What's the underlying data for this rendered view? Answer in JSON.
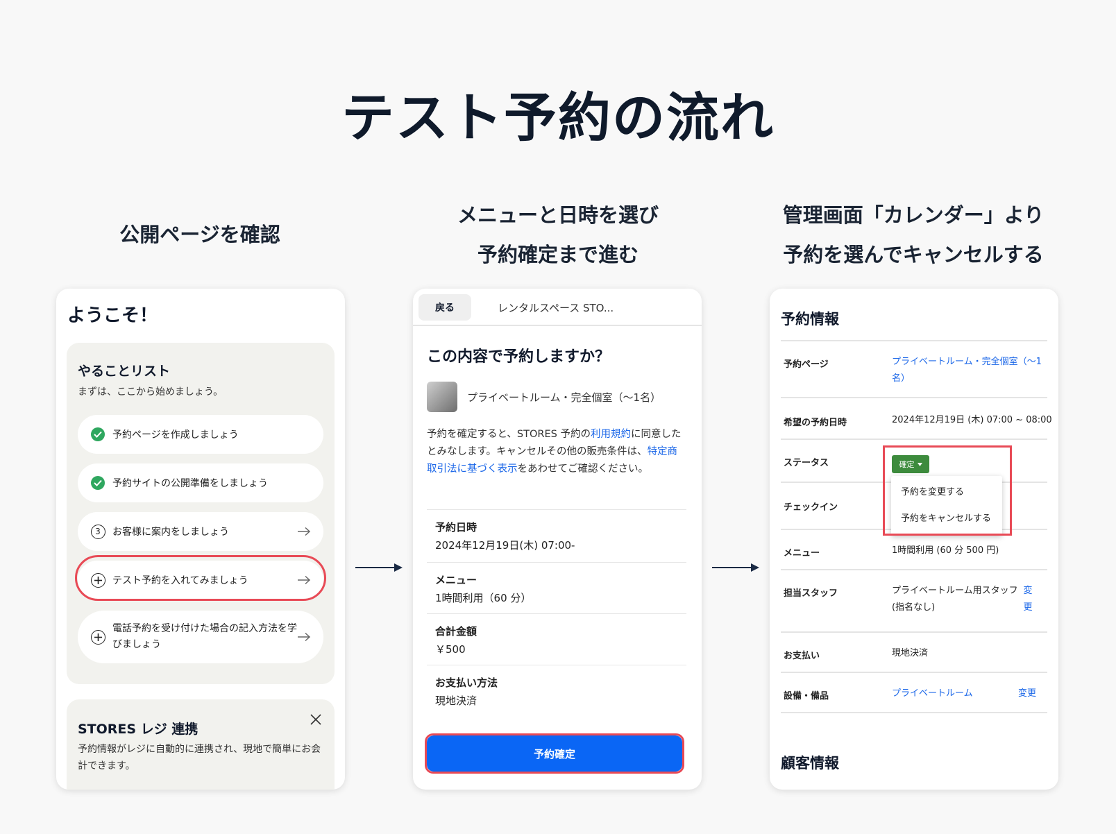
{
  "title": "テスト予約の流れ",
  "steps": [
    {
      "lines": [
        "公開ページを確認"
      ]
    },
    {
      "lines": [
        "メニューと日時を選び",
        "予約確定まで進む"
      ]
    },
    {
      "lines": [
        "管理画面「カレンダー」より",
        "予約を選んでキャンセルする"
      ]
    }
  ],
  "card1": {
    "welcome": "ようこそ！",
    "todo_title": "やることリスト",
    "todo_subtitle": "まずは、ここから始めましょう。",
    "todos": [
      {
        "label": "予約ページを作成しましょう",
        "status": "done"
      },
      {
        "label": "予約サイトの公開準備をしましょう",
        "status": "done"
      },
      {
        "label": "お客様に案内をしましょう",
        "number": "3"
      },
      {
        "label": "テスト予約を入れてみましょう",
        "icon": "plus"
      },
      {
        "label": "電話予約を受け付けた場合の記入方法を学びましょう",
        "icon": "plus"
      }
    ],
    "stores_title": "STORES レジ 連携",
    "stores_text": "予約情報がレジに自動的に連携され、現地で簡単にお会計できます。"
  },
  "card2": {
    "back": "戻る",
    "store_name": "レンタルスペース STO...",
    "question": "この内容で予約しますか？",
    "room": "プライベートルーム・完全個室（〜1名）",
    "terms_1": "予約を確定すると、STORES 予約の",
    "terms_link1": "利用規約",
    "terms_2": "に同意したとみなします。キャンセルその他の販売条件は、",
    "terms_link2": "特定商取引法に基づく表示",
    "terms_3": "をあわせてご確認ください。",
    "rows": [
      {
        "label": "予約日時",
        "value": "2024年12月19日(木) 07:00-"
      },
      {
        "label": "メニュー",
        "value": "1時間利用（60 分）"
      },
      {
        "label": "合計金額",
        "value": "￥500"
      },
      {
        "label": "お支払い方法",
        "value": "現地決済"
      }
    ],
    "confirm": "予約確定"
  },
  "card3": {
    "title": "予約情報",
    "labels": {
      "page": "予約ページ",
      "datetime": "希望の予約日時",
      "status": "ステータス",
      "checkin": "チェックイン",
      "menu": "メニュー",
      "staff": "担当スタッフ",
      "payment": "お支払い",
      "equipment": "設備・備品"
    },
    "values": {
      "page": "プライベートルーム・完全個室（〜1名）",
      "datetime": "2024年12月19日 (木) 07:00 ~ 08:00",
      "status": "確定",
      "menu": "1時間利用 (60 分 500 円)",
      "staff": "プライベートルーム用スタッフ (指名なし)",
      "payment": "現地決済",
      "equipment": "プライベートルーム"
    },
    "change": "変更",
    "menu_items": [
      "予約を変更する",
      "予約をキャンセルする"
    ],
    "customer_title": "顧客情報"
  },
  "colors": {
    "highlight": "#e84a56",
    "primary": "#0a66f5",
    "link": "#1a66e8",
    "success": "#2fa75f",
    "status_badge": "#3d8b3d"
  }
}
